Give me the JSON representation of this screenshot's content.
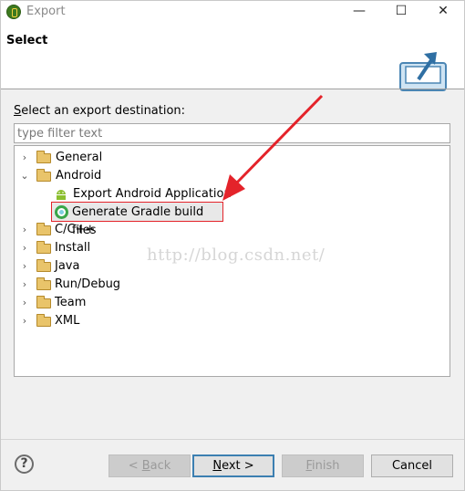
{
  "window": {
    "title": "Export",
    "minimize_glyph": "—",
    "maximize_glyph": "☐",
    "close_glyph": "✕"
  },
  "header": {
    "title": "Select",
    "icon": "export-icon"
  },
  "destination": {
    "label_prefix": "",
    "label_mnemonic": "S",
    "label_rest": "elect an export destination:",
    "filter_placeholder": "type filter text",
    "filter_value": ""
  },
  "tree": {
    "items": [
      {
        "label": "General",
        "expanded": false,
        "icon": "folder-icon"
      },
      {
        "label": "Android",
        "expanded": true,
        "icon": "folder-icon"
      },
      {
        "label": "Export Android Application",
        "icon": "android-icon"
      },
      {
        "label": "Generate Gradle build files",
        "icon": "gradle-icon",
        "selected": true
      },
      {
        "label": "C/C++",
        "expanded": false,
        "icon": "folder-icon"
      },
      {
        "label": "Install",
        "expanded": false,
        "icon": "folder-icon"
      },
      {
        "label": "Java",
        "expanded": false,
        "icon": "folder-icon"
      },
      {
        "label": "Run/Debug",
        "expanded": false,
        "icon": "folder-icon"
      },
      {
        "label": "Team",
        "expanded": false,
        "icon": "folder-icon"
      },
      {
        "label": "XML",
        "expanded": false,
        "icon": "folder-icon"
      }
    ]
  },
  "watermark": "http://blog.csdn.net/",
  "buttons": {
    "help": "?",
    "back": "< Back",
    "next": "Next >",
    "finish": "Finish",
    "cancel": "Cancel",
    "back_enabled": false,
    "finish_enabled": false
  },
  "colors": {
    "highlight_border": "#e4232a",
    "arrow": "#e4232a",
    "default_button_border": "#3c7fb1"
  }
}
